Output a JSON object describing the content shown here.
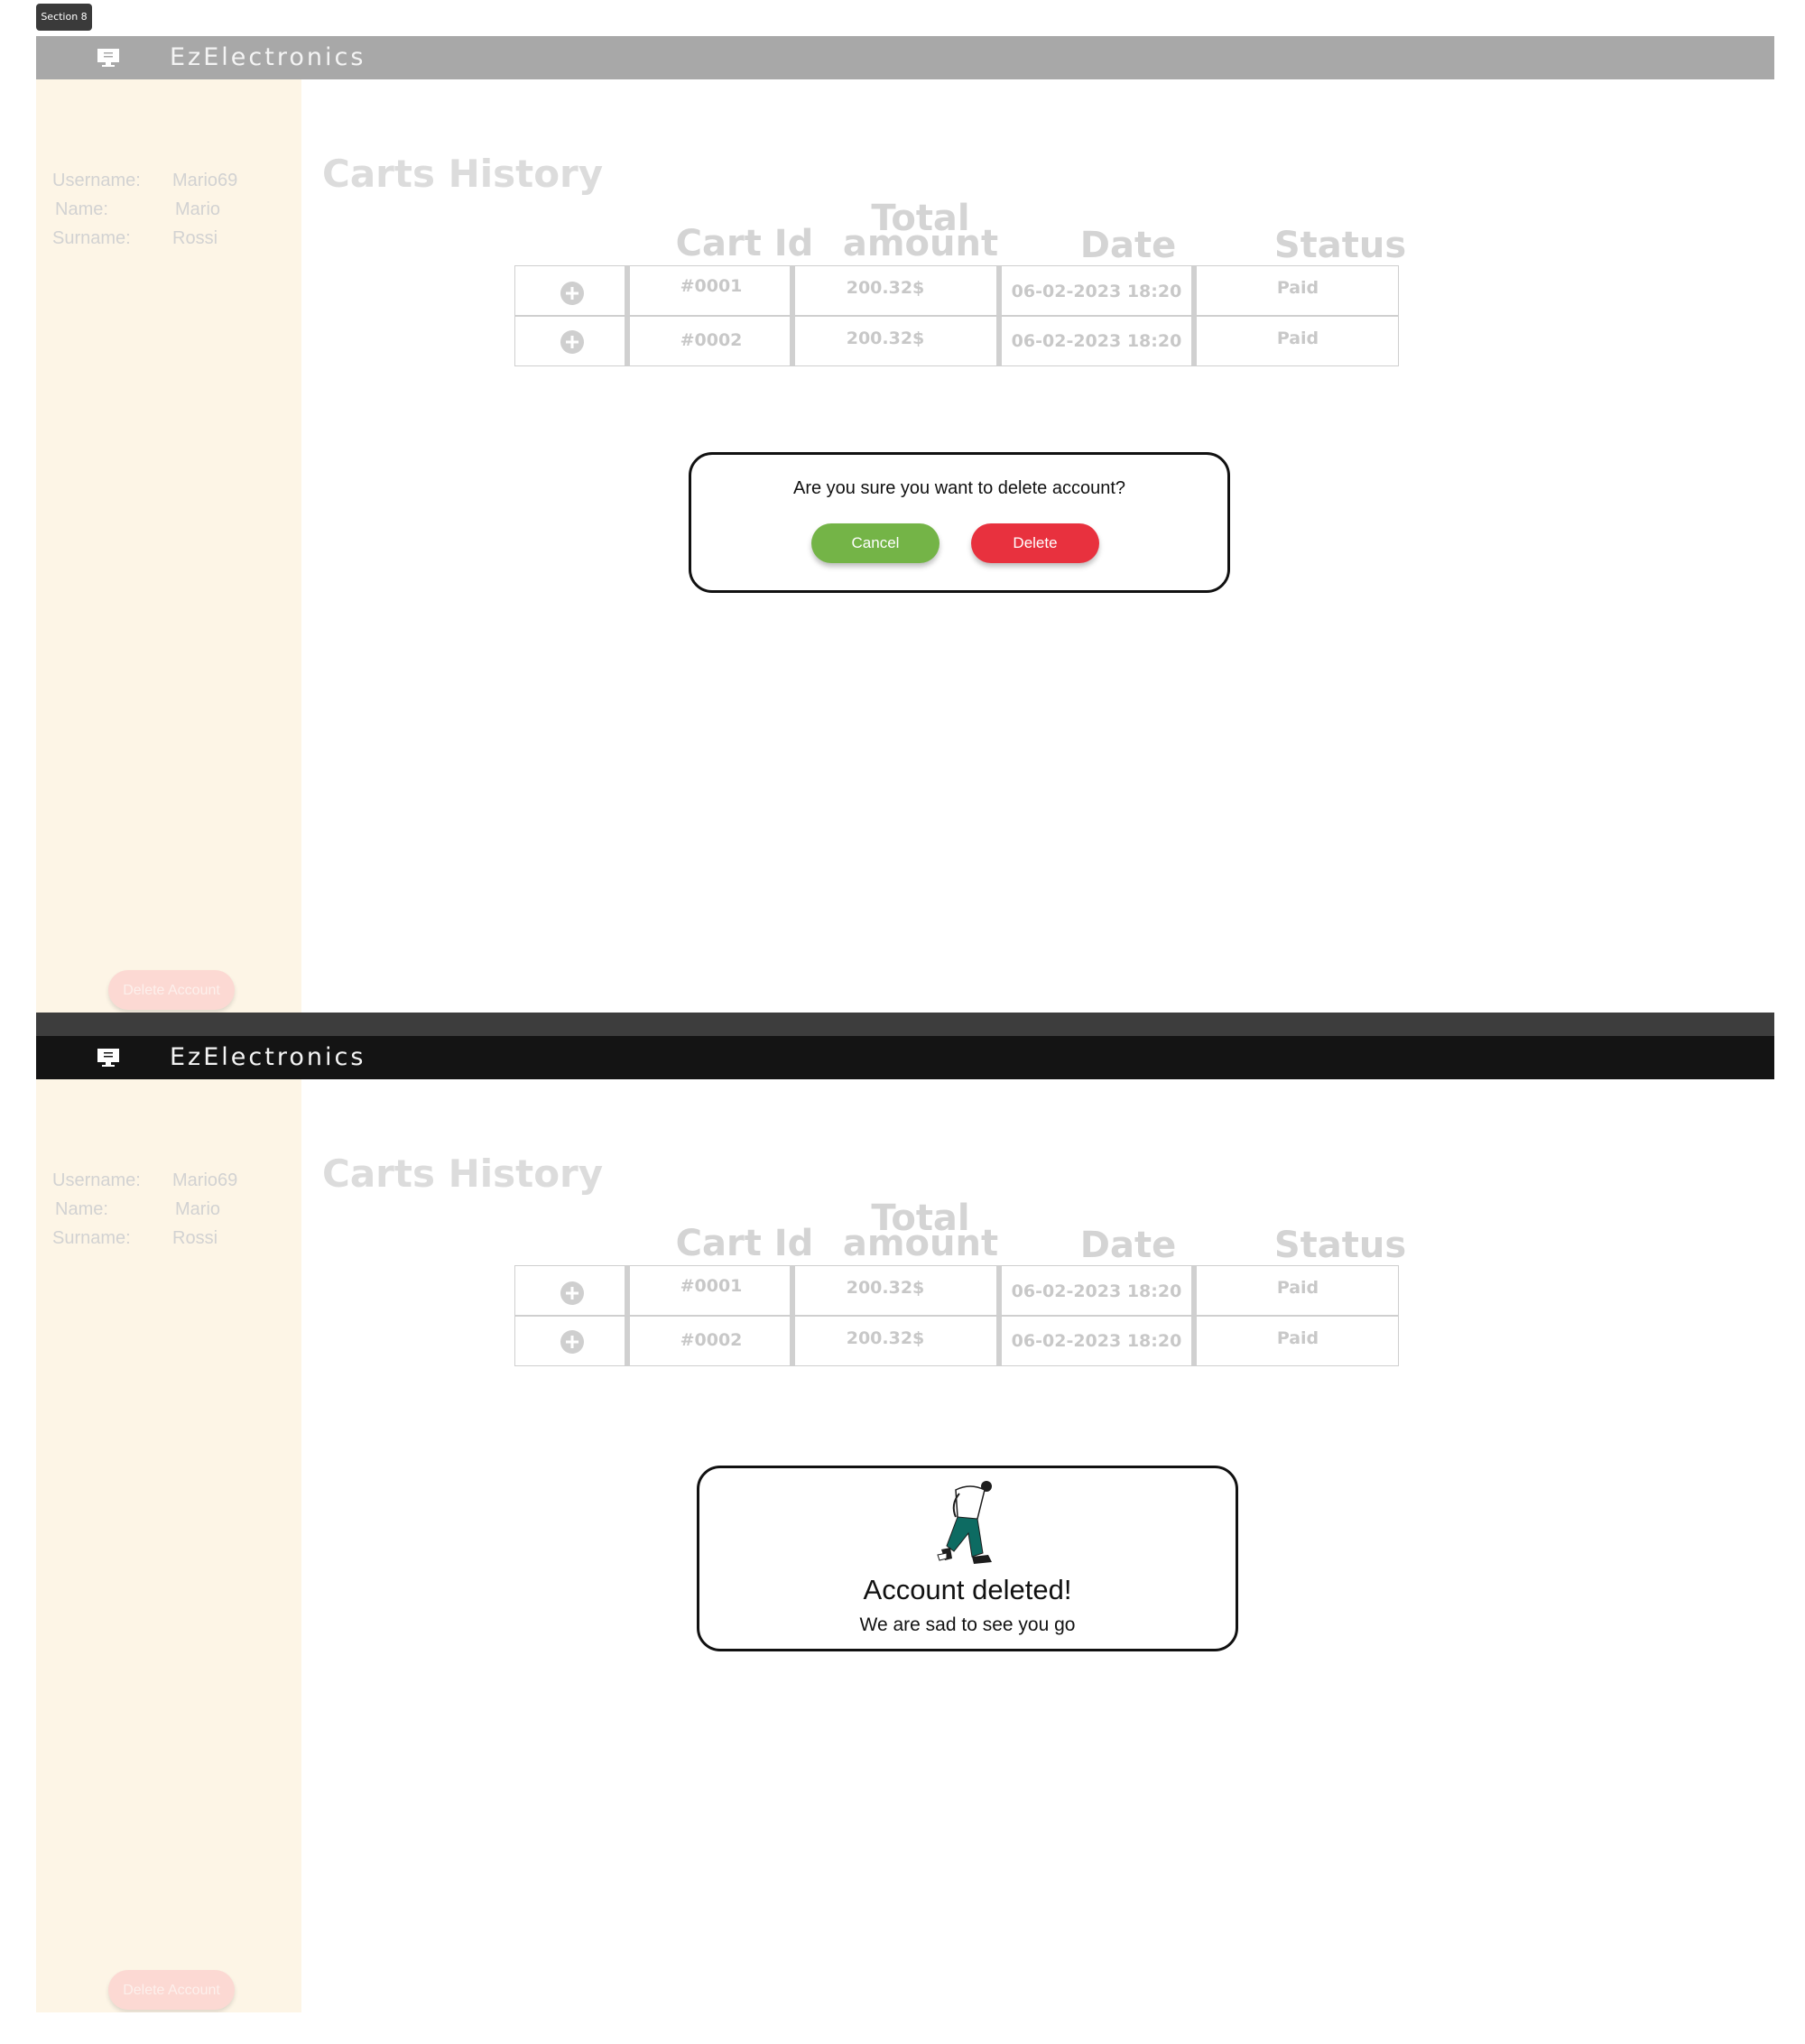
{
  "section_tag": "Section 8",
  "app": {
    "brand": "EzElectronics"
  },
  "user": {
    "fields": [
      {
        "label": "Username:",
        "value": "Mario69"
      },
      {
        "label": "Name:",
        "value": "Mario"
      },
      {
        "label": "Surname:",
        "value": "Rossi"
      }
    ],
    "delete_label": "Delete Account"
  },
  "carts": {
    "title": "Carts History",
    "columns": [
      "Cart Id",
      "Total amount",
      "Date",
      "Status"
    ],
    "rows": [
      {
        "id": "#0001",
        "total": "200.32$",
        "date": "06-02-2023 18:20",
        "status": "Paid"
      },
      {
        "id": "#0002",
        "total": "200.32$",
        "date": "06-02-2023 18:20",
        "status": "Paid"
      }
    ]
  },
  "confirm_dialog": {
    "question": "Are you sure you want to delete account?",
    "cancel_label": "Cancel",
    "delete_label": "Delete",
    "cancel_color": "#74b447",
    "delete_color": "#e8313e"
  },
  "deleted_dialog": {
    "title": "Account deleted!",
    "subtitle": "We are sad to see you go"
  },
  "colors": {
    "sidebar": "#fdf5e6",
    "topbar_light": "#a8a8a8",
    "topbar_dark": "#141414"
  },
  "icons": [
    "monitor-logo-icon",
    "plus-circle-icon",
    "walking-person-illustration"
  ]
}
